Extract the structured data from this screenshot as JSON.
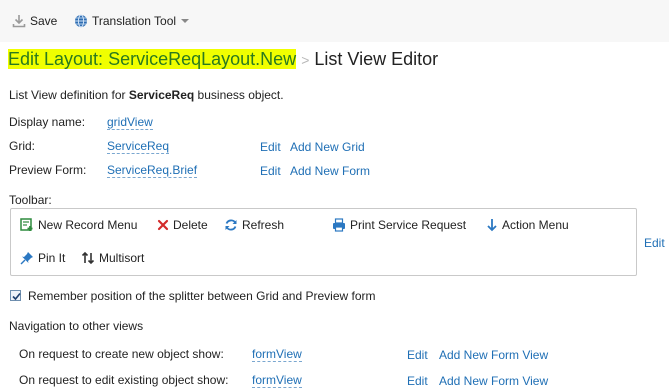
{
  "topbar": {
    "save_label": "Save",
    "translation_label": "Translation Tool"
  },
  "header": {
    "crumb_link": "Edit Layout: ServiceReqLayout.New",
    "separator": ">",
    "title": "List View Editor"
  },
  "intro": {
    "prefix": "List View definition for ",
    "object_name": "ServiceReq",
    "suffix": " business object."
  },
  "fields": {
    "display_name_label": "Display name:",
    "display_name_value": "gridView",
    "grid_label": "Grid:",
    "grid_value": "ServiceReq",
    "grid_edit": "Edit",
    "grid_add": "Add New Grid",
    "preview_label": "Preview Form:",
    "preview_value": "ServiceReq.Brief",
    "preview_edit": "Edit",
    "preview_add": "Add New Form"
  },
  "toolbar_section": {
    "label": "Toolbar:",
    "edit": "Edit",
    "buttons": [
      {
        "label": "New Record Menu",
        "icon": "new-record-icon",
        "color": "#2e8b3e"
      },
      {
        "label": "Delete",
        "icon": "delete-x-icon",
        "color": "#d32b2b"
      },
      {
        "label": "Refresh",
        "icon": "refresh-icon",
        "color": "#2b78c2"
      },
      {
        "label": "Print Service Request",
        "icon": "printer-icon",
        "color": "#2b78c2"
      },
      {
        "label": "Action Menu",
        "icon": "arrow-down-icon",
        "color": "#2b78c2"
      },
      {
        "label": "Pin It",
        "icon": "pin-icon",
        "color": "#2b78c2"
      },
      {
        "label": "Multisort",
        "icon": "sort-arrows-icon",
        "color": "#333333"
      }
    ]
  },
  "splitter": {
    "checked": true,
    "label": "Remember position of the splitter between Grid and Preview form"
  },
  "navigation": {
    "heading": "Navigation to other views",
    "rows": [
      {
        "label": "On request to create new object show:",
        "value": "formView",
        "edit": "Edit",
        "add": "Add New Form View"
      },
      {
        "label": "On request to edit existing object show:",
        "value": "formView",
        "edit": "Edit",
        "add": "Add New Form View"
      }
    ]
  }
}
